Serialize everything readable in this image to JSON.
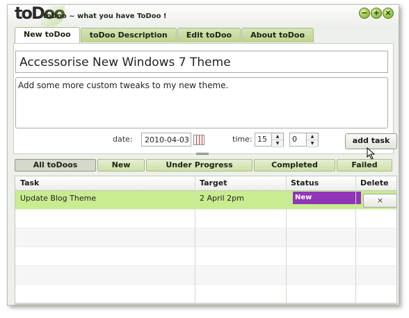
{
  "app": {
    "logo_text": "toDoo",
    "title": "toDoo ~ what you have ToDoo !",
    "window_buttons": {
      "minimize": "−",
      "maximize": "+",
      "close": "×"
    }
  },
  "tabs": [
    {
      "label": "New toDoo",
      "active": true
    },
    {
      "label": "toDoo Description",
      "active": false
    },
    {
      "label": "Edit toDoo",
      "active": false
    },
    {
      "label": "About toDoo",
      "active": false
    }
  ],
  "form": {
    "title_value": "Accessorise New Windows 7 Theme",
    "description_value": "Add some more custom tweaks to my new theme.",
    "date_label": "date:",
    "date_value": "2010-04-03",
    "time_label": "time:",
    "hour_value": "15",
    "minute_value": "0",
    "add_button": "add task"
  },
  "filters": [
    {
      "label": "All toDoos",
      "active": true
    },
    {
      "label": "New",
      "active": false
    },
    {
      "label": "Under Progress",
      "active": false
    },
    {
      "label": "Completed",
      "active": false
    },
    {
      "label": "Failed",
      "active": false
    }
  ],
  "table": {
    "headers": {
      "task": "Task",
      "target": "Target",
      "status": "Status",
      "delete": "Delete"
    },
    "rows": [
      {
        "task": "Update Blog Theme",
        "target": "2 April 2pm",
        "status": "New",
        "delete": "×"
      }
    ]
  },
  "colors": {
    "accent_green": "#c8ec8f",
    "status_new": "#8f35b5",
    "tab_green": "#bfd38f"
  }
}
